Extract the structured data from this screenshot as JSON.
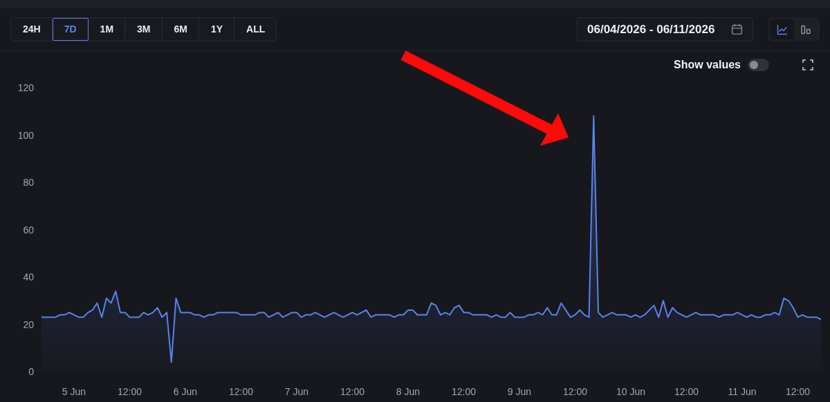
{
  "ranges": [
    {
      "label": "24H",
      "selected": false
    },
    {
      "label": "7D",
      "selected": true
    },
    {
      "label": "1M",
      "selected": false
    },
    {
      "label": "3M",
      "selected": false
    },
    {
      "label": "6M",
      "selected": false
    },
    {
      "label": "1Y",
      "selected": false
    },
    {
      "label": "ALL",
      "selected": false
    }
  ],
  "date_range": {
    "value": "06/04/2026 - 06/11/2026"
  },
  "chart_types": [
    {
      "kind": "line",
      "selected": true
    },
    {
      "kind": "bar",
      "selected": false
    }
  ],
  "show_values": {
    "label": "Show values",
    "on": false
  },
  "chart": {
    "chart_data": {
      "type": "area",
      "ylim": [
        0,
        120
      ],
      "yticks": [
        0,
        20,
        40,
        60,
        80,
        100,
        120
      ],
      "categories": [
        null,
        null,
        null,
        null,
        null,
        null,
        null,
        "5 Jun",
        null,
        null,
        null,
        null,
        null,
        null,
        null,
        null,
        null,
        null,
        null,
        "12:00",
        null,
        null,
        null,
        null,
        null,
        null,
        null,
        null,
        null,
        null,
        null,
        "6 Jun",
        null,
        null,
        null,
        null,
        null,
        null,
        null,
        null,
        null,
        null,
        null,
        "12:00",
        null,
        null,
        null,
        null,
        null,
        null,
        null,
        null,
        null,
        null,
        null,
        "7 Jun",
        null,
        null,
        null,
        null,
        null,
        null,
        null,
        null,
        null,
        null,
        null,
        "12:00",
        null,
        null,
        null,
        null,
        null,
        null,
        null,
        null,
        null,
        null,
        null,
        "8 Jun",
        null,
        null,
        null,
        null,
        null,
        null,
        null,
        null,
        null,
        null,
        null,
        "12:00",
        null,
        null,
        null,
        null,
        null,
        null,
        null,
        null,
        null,
        null,
        null,
        "9 Jun",
        null,
        null,
        null,
        null,
        null,
        null,
        null,
        null,
        null,
        null,
        null,
        "12:00",
        null,
        null,
        null,
        null,
        null,
        null,
        null,
        null,
        null,
        null,
        null,
        "10 Jun",
        null,
        null,
        null,
        null,
        null,
        null,
        null,
        null,
        null,
        null,
        null,
        "12:00",
        null,
        null,
        null,
        null,
        null,
        null,
        null,
        null,
        null,
        null,
        null,
        "11 Jun",
        null,
        null,
        null,
        null,
        null,
        null,
        null,
        null,
        null,
        null,
        null,
        "12:00",
        null,
        null,
        null,
        null,
        null
      ],
      "series": [
        {
          "color": "#5b82f0",
          "values": [
            23,
            23,
            23,
            23,
            24,
            24,
            25,
            24,
            23,
            23,
            25,
            26,
            29,
            23,
            31,
            29,
            34,
            25,
            25,
            23,
            23,
            23,
            25,
            24,
            25,
            27,
            23,
            25,
            4,
            31,
            25,
            25,
            25,
            24,
            24,
            23,
            24,
            24,
            25,
            25,
            25,
            25,
            25,
            24,
            24,
            24,
            24,
            25,
            25,
            23,
            24,
            25,
            23,
            24,
            25,
            25,
            23,
            24,
            24,
            25,
            24,
            23,
            24,
            25,
            24,
            23,
            24,
            25,
            24,
            25,
            26,
            23,
            24,
            24,
            24,
            24,
            23,
            24,
            24,
            26,
            26,
            24,
            24,
            24,
            29,
            28,
            24,
            25,
            24,
            27,
            28,
            25,
            25,
            24,
            24,
            24,
            24,
            23,
            24,
            23,
            23,
            25,
            23,
            23,
            23,
            24,
            24,
            25,
            24,
            27,
            24,
            24,
            29,
            26,
            23,
            24,
            26,
            24,
            23,
            108,
            25,
            23,
            24,
            25,
            24,
            24,
            24,
            23,
            24,
            23,
            24,
            26,
            28,
            23,
            30,
            23,
            27,
            25,
            24,
            23,
            24,
            25,
            24,
            24,
            24,
            24,
            23,
            24,
            24,
            24,
            25,
            24,
            23,
            24,
            23,
            23,
            24,
            24,
            25,
            24,
            31,
            30,
            27,
            23,
            24,
            23,
            23,
            23,
            22
          ]
        }
      ]
    }
  }
}
